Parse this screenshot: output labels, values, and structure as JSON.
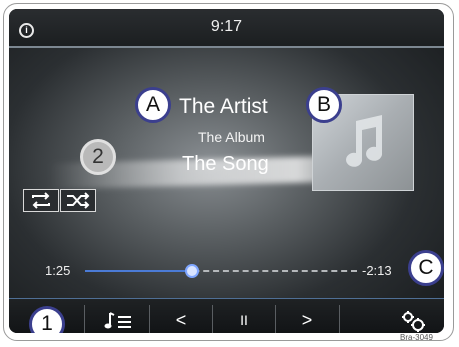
{
  "status_bar": {
    "time": "9:17",
    "info_icon": "i"
  },
  "now_playing": {
    "artist": "The Artist",
    "album": "The Album",
    "song": "The Song"
  },
  "callouts": {
    "a": "A",
    "b": "B",
    "c": "C",
    "one": "1",
    "two": "2"
  },
  "playback": {
    "elapsed": "1:25",
    "remaining": "-2:13",
    "progress_fraction": 0.39
  },
  "controls": {
    "previous": "<",
    "pause": "II",
    "next": ">"
  },
  "icons": [
    "info-icon",
    "repeat-icon",
    "shuffle-icon",
    "music-note-icon",
    "playlist-icon",
    "previous-icon",
    "pause-icon",
    "next-icon",
    "settings-icon"
  ],
  "colors": {
    "accent": "#4b7bd6",
    "callout_border": "#3b3f8e"
  },
  "watermark": "Bra-3049"
}
